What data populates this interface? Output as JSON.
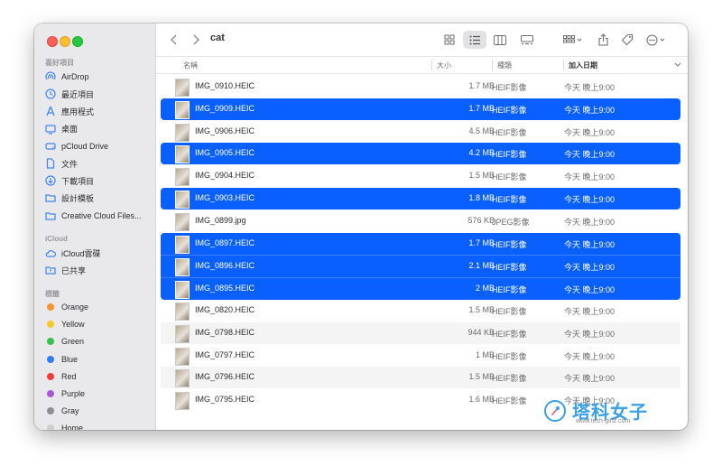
{
  "toolbar": {
    "title": "cat"
  },
  "sidebar": {
    "favorites_title": "喜好項目",
    "favorites": [
      {
        "label": "AirDrop",
        "icon": "airdrop-icon"
      },
      {
        "label": "最近項目",
        "icon": "clock-icon"
      },
      {
        "label": "應用程式",
        "icon": "apps-icon"
      },
      {
        "label": "桌面",
        "icon": "desktop-icon"
      },
      {
        "label": "pCloud Drive",
        "icon": "drive-icon"
      },
      {
        "label": "文件",
        "icon": "document-icon"
      },
      {
        "label": "下載項目",
        "icon": "download-icon"
      },
      {
        "label": "設計模板",
        "icon": "folder-icon"
      },
      {
        "label": "Creative Cloud Files...",
        "icon": "folder-icon"
      }
    ],
    "icloud_title": "iCloud",
    "icloud": [
      {
        "label": "iCloud雲碟",
        "icon": "cloud-icon"
      },
      {
        "label": "已共享",
        "icon": "shared-folder-icon"
      }
    ],
    "tags_title": "標籤",
    "tags": [
      {
        "label": "Orange",
        "color": "#f7952f"
      },
      {
        "label": "Yellow",
        "color": "#f6c928"
      },
      {
        "label": "Green",
        "color": "#35c24a"
      },
      {
        "label": "Blue",
        "color": "#2f7cf6"
      },
      {
        "label": "Red",
        "color": "#ef3d3d"
      },
      {
        "label": "Purple",
        "color": "#a857d8"
      },
      {
        "label": "Gray",
        "color": "#8e8e93"
      },
      {
        "label": "Home",
        "color": "#cfcfcf"
      }
    ]
  },
  "columns": {
    "name": "名稱",
    "size": "大小",
    "kind": "種類",
    "date": "加入日期"
  },
  "files": [
    {
      "name": "IMG_0910.HEIC",
      "size": "1.7 MB",
      "kind": "HEIF影像",
      "date": "今天 晚上9:00",
      "selected": false
    },
    {
      "name": "IMG_0909.HEIC",
      "size": "1.7 MB",
      "kind": "HEIF影像",
      "date": "今天 晚上9:00",
      "selected": true
    },
    {
      "name": "IMG_0906.HEIC",
      "size": "4.5 MB",
      "kind": "HEIF影像",
      "date": "今天 晚上9:00",
      "selected": false
    },
    {
      "name": "IMG_0905.HEIC",
      "size": "4.2 MB",
      "kind": "HEIF影像",
      "date": "今天 晚上9:00",
      "selected": true
    },
    {
      "name": "IMG_0904.HEIC",
      "size": "1.5 MB",
      "kind": "HEIF影像",
      "date": "今天 晚上9:00",
      "selected": false
    },
    {
      "name": "IMG_0903.HEIC",
      "size": "1.8 MB",
      "kind": "HEIF影像",
      "date": "今天 晚上9:00",
      "selected": true
    },
    {
      "name": "IMG_0899.jpg",
      "size": "576 KB",
      "kind": "JPEG影像",
      "date": "今天 晚上9:00",
      "selected": false
    },
    {
      "name": "IMG_0897.HEIC",
      "size": "1.7 MB",
      "kind": "HEIF影像",
      "date": "今天 晚上9:00",
      "selected": true
    },
    {
      "name": "IMG_0896.HEIC",
      "size": "2.1 MB",
      "kind": "HEIF影像",
      "date": "今天 晚上9:00",
      "selected": true
    },
    {
      "name": "IMG_0895.HEIC",
      "size": "2 MB",
      "kind": "HEIF影像",
      "date": "今天 晚上9:00",
      "selected": true
    },
    {
      "name": "IMG_0820.HEIC",
      "size": "1.5 MB",
      "kind": "HEIF影像",
      "date": "今天 晚上9:00",
      "selected": false
    },
    {
      "name": "IMG_0798.HEIC",
      "size": "944 KB",
      "kind": "HEIF影像",
      "date": "今天 晚上9:00",
      "selected": false
    },
    {
      "name": "IMG_0797.HEIC",
      "size": "1 MB",
      "kind": "HEIF影像",
      "date": "今天 晚上9:00",
      "selected": false
    },
    {
      "name": "IMG_0796.HEIC",
      "size": "1.5 MB",
      "kind": "HEIF影像",
      "date": "今天 晚上9:00",
      "selected": false
    },
    {
      "name": "IMG_0795.HEIC",
      "size": "1.6 MB",
      "kind": "HEIF影像",
      "date": "今天 晚上9:00",
      "selected": false
    }
  ],
  "watermark": {
    "title": "塔科女子",
    "url": "www.tech-girlz.com"
  },
  "colors": {
    "selection": "#0a60ff",
    "sidebar_accent": "#3d86f0"
  }
}
